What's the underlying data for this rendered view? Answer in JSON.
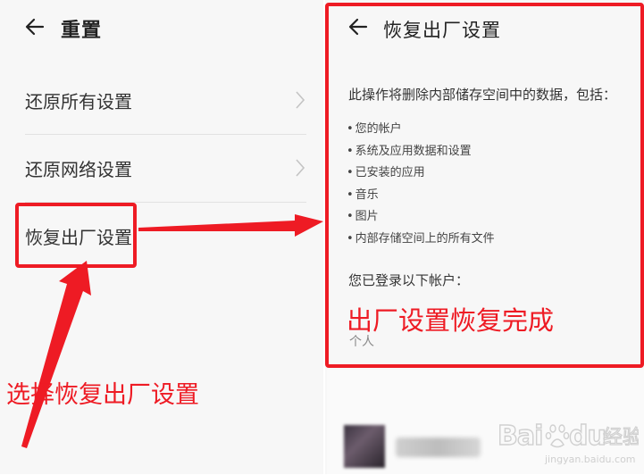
{
  "left": {
    "title": "重置",
    "items": [
      {
        "label": "还原所有设置"
      },
      {
        "label": "还原网络设置"
      },
      {
        "label": "恢复出厂设置"
      }
    ]
  },
  "right": {
    "title": "恢复出厂设置",
    "description": "此操作将删除内部储存空间中的数据，包括：",
    "bullets": [
      "您的帐户",
      "系统及应用数据和设置",
      "已安装的应用",
      "音乐",
      "图片",
      "内部存储空间上的所有文件"
    ],
    "account_title": "您已登录以下帐户：",
    "account_type": "个人"
  },
  "annotations": {
    "select_hint": "选择恢复出厂设置",
    "done_hint": "出厂设置恢复完成"
  },
  "watermark": {
    "text": "Baidu经验",
    "sub": "jingyan.baidu.com"
  },
  "colors": {
    "annotation_red": "#ee1b24"
  }
}
